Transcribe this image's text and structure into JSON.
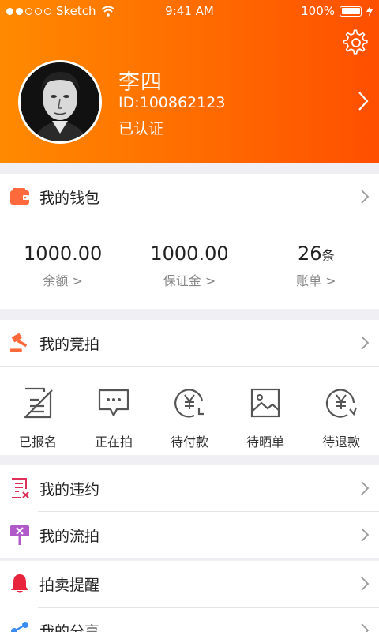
{
  "status_bar": {
    "carrier": "Sketch",
    "time": "9:41 AM",
    "battery": "100%"
  },
  "profile": {
    "name": "李四",
    "id": "ID:100862123",
    "status": "已认证"
  },
  "wallet": {
    "title": "我的钱包",
    "stats": [
      {
        "value": "1000.00",
        "unit": "",
        "label": "余额 >"
      },
      {
        "value": "1000.00",
        "unit": "",
        "label": "保证金 >"
      },
      {
        "value": "26",
        "unit": "条",
        "label": "账单 >"
      }
    ]
  },
  "auction": {
    "title": "我的竞拍",
    "items": [
      {
        "label": "已报名",
        "icon": "form-icon"
      },
      {
        "label": "正在拍",
        "icon": "chat-icon"
      },
      {
        "label": "待付款",
        "icon": "yen-clock-icon"
      },
      {
        "label": "待晒单",
        "icon": "image-icon"
      },
      {
        "label": "待退款",
        "icon": "yen-refund-icon"
      }
    ]
  },
  "menu": {
    "violation": "我的违约",
    "unsold": "我的流拍",
    "reminder": "拍卖提醒",
    "share": "我的分享"
  },
  "colors": {
    "accent": "#ff6a00",
    "wallet_icon": "#ff6a3d",
    "violation_icon": "#e0305a",
    "unsold_icon": "#b05ac9",
    "reminder_icon": "#e8233c",
    "share_icon": "#3b8cf0"
  }
}
